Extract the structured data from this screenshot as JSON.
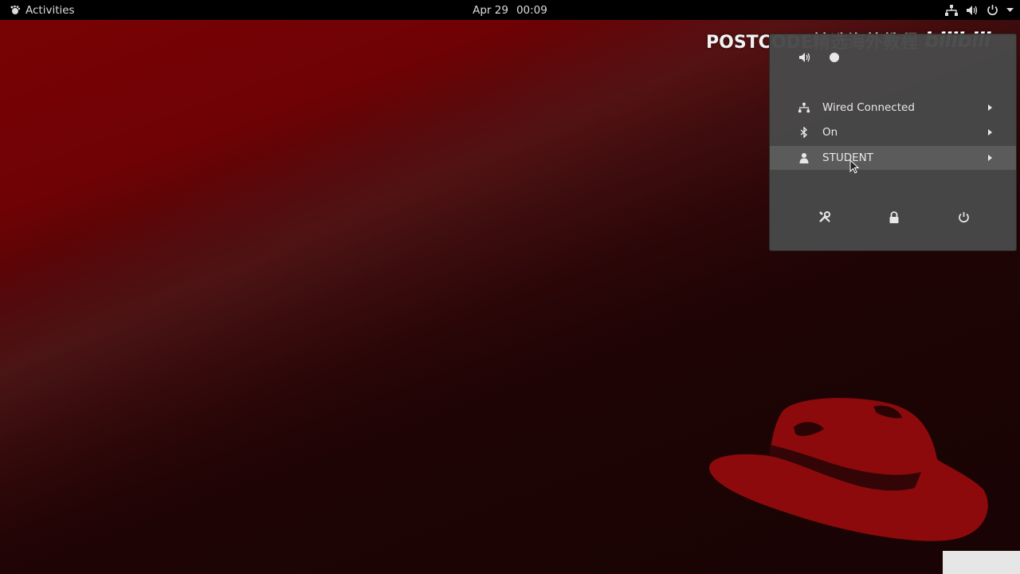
{
  "topbar": {
    "activities_label": "Activities",
    "date": "Apr 29",
    "time": "00:09",
    "icons": [
      "network-icon",
      "volume-icon",
      "power-icon",
      "dropdown-arrow-icon"
    ]
  },
  "watermark": {
    "text": "POSTCODE精选海外教程",
    "logo_text": "bilibili"
  },
  "system_menu": {
    "volume_icon": "volume-icon",
    "volume_level": 0.0,
    "items": [
      {
        "icon": "network-icon",
        "label": "Wired Connected"
      },
      {
        "icon": "bluetooth-icon",
        "label": "On"
      },
      {
        "icon": "user-icon",
        "label": "STUDENT"
      }
    ],
    "actions": [
      "settings-icon",
      "lock-icon",
      "power-off-icon"
    ]
  },
  "colors": {
    "topbar_bg": "#000000",
    "menu_bg": "#484848",
    "menu_text": "#e8e8e8",
    "wallpaper_red": "#7a0304",
    "hat_red": "#8c0a0b"
  }
}
